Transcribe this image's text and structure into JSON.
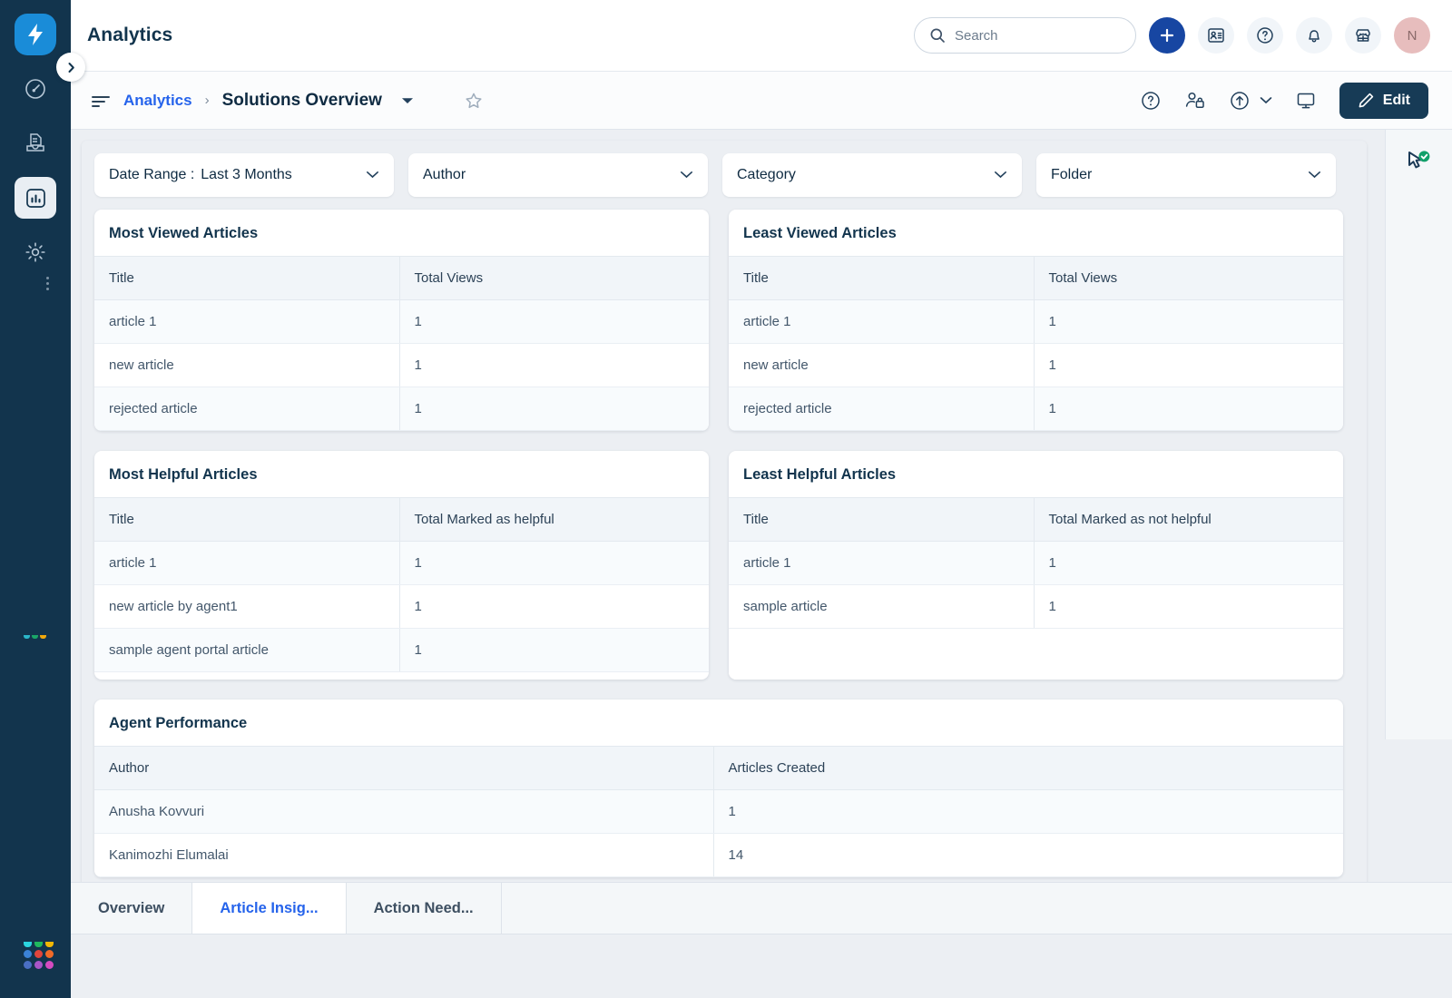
{
  "app": {
    "brand_icon": "lightning-bolt-logo",
    "page_title": "Analytics",
    "avatar_initial": "N"
  },
  "left_rail": {
    "items": [
      {
        "name": "dashboard",
        "icon": "gauge-icon",
        "active": false
      },
      {
        "name": "tickets",
        "icon": "document-tray-icon",
        "active": false
      },
      {
        "name": "analytics",
        "icon": "bar-chart-icon",
        "active": true
      },
      {
        "name": "admin",
        "icon": "gear-icon",
        "active": false
      }
    ],
    "expand_icon": "chevron-right-icon",
    "app_switcher_icon": "app-grid-icon"
  },
  "header": {
    "search": {
      "placeholder": "Search",
      "icon": "search-icon",
      "value": ""
    },
    "actions": [
      {
        "name": "add-new",
        "icon": "plus-icon"
      },
      {
        "name": "contacts",
        "icon": "contact-card-icon"
      },
      {
        "name": "help",
        "icon": "question-circle-icon"
      },
      {
        "name": "notifications",
        "icon": "bell-icon"
      },
      {
        "name": "marketplace",
        "icon": "storefront-icon"
      }
    ]
  },
  "toolbar": {
    "menu_icon": "hamburger-icon",
    "breadcrumb_root": "Analytics",
    "breadcrumb_separator": "›",
    "breadcrumb_current": "Solutions Overview",
    "dropdown_icon": "caret-down-icon",
    "favorite_icon": "star-outline-icon",
    "right_actions": [
      {
        "name": "help",
        "icon": "question-circle-icon"
      },
      {
        "name": "share-access",
        "icon": "user-access-icon"
      },
      {
        "name": "export",
        "icon": "export-up-icon"
      },
      {
        "name": "presentation-mode",
        "icon": "monitor-icon"
      }
    ],
    "edit_label": "Edit",
    "edit_icon": "pencil-icon"
  },
  "filters": [
    {
      "name": "date-range",
      "label": "Date Range :",
      "value": "Last 3 Months",
      "icon": "chevron-down-icon"
    },
    {
      "name": "author",
      "label": "Author",
      "value": "",
      "icon": "chevron-down-icon"
    },
    {
      "name": "category",
      "label": "Category",
      "value": "",
      "icon": "chevron-down-icon"
    },
    {
      "name": "folder",
      "label": "Folder",
      "value": "",
      "icon": "chevron-down-icon"
    }
  ],
  "cards": [
    {
      "id": "most-viewed-articles",
      "title": "Most Viewed Articles",
      "columns": [
        "Title",
        "Total Views"
      ],
      "rows": [
        [
          "article 1",
          "1"
        ],
        [
          "new article",
          "1"
        ],
        [
          "rejected article",
          "1"
        ]
      ]
    },
    {
      "id": "least-viewed-articles",
      "title": "Least Viewed Articles",
      "columns": [
        "Title",
        "Total Views"
      ],
      "rows": [
        [
          "article 1",
          "1"
        ],
        [
          "new article",
          "1"
        ],
        [
          "rejected article",
          "1"
        ]
      ]
    },
    {
      "id": "most-helpful-articles",
      "title": "Most Helpful Articles",
      "columns": [
        "Title",
        "Total Marked as helpful"
      ],
      "rows": [
        [
          "article 1",
          "1"
        ],
        [
          "new article by agent1",
          "1"
        ],
        [
          "sample agent portal article",
          "1"
        ]
      ]
    },
    {
      "id": "least-helpful-articles",
      "title": "Least Helpful Articles",
      "columns": [
        "Title",
        "Total Marked as not helpful"
      ],
      "rows": [
        [
          "article 1",
          "1"
        ],
        [
          "sample article",
          "1"
        ]
      ]
    },
    {
      "id": "agent-performance",
      "title": "Agent Performance",
      "columns": [
        "Author",
        "Articles Created"
      ],
      "rows": [
        [
          "Anusha Kovvuri",
          "1"
        ],
        [
          "Kanimozhi Elumalai",
          "14"
        ]
      ]
    }
  ],
  "right_panel": {
    "icon": "cursor-check-icon"
  },
  "tabs": [
    {
      "label": "Overview",
      "active": false
    },
    {
      "label": "Article Insig...",
      "active": true
    },
    {
      "label": "Action Need...",
      "active": false
    }
  ],
  "colors": {
    "rail_bg": "#12344d",
    "brand_blue": "#1a8cd8",
    "accent_blue": "#2563eb",
    "add_button": "#1746a2",
    "edit_button": "#173b56",
    "canvas_bg": "#eceff3",
    "avatar_bg": "#e7bdbd",
    "check_green": "#11a06a"
  }
}
